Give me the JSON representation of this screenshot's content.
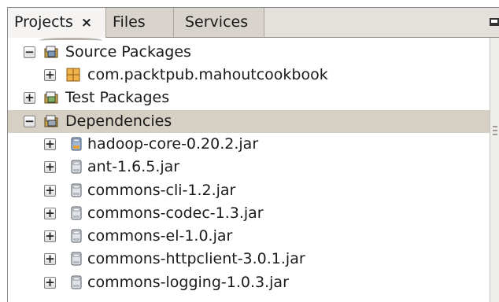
{
  "tabs": {
    "projects": "Projects",
    "projects_close": "×",
    "files": "Files",
    "services": "Services"
  },
  "tree": {
    "source_packages": "Source Packages",
    "package": "com.packtpub.mahoutcookbook",
    "test_packages": "Test Packages",
    "dependencies": "Dependencies",
    "jars": [
      "hadoop-core-0.20.2.jar",
      "ant-1.6.5.jar",
      "commons-cli-1.2.jar",
      "commons-codec-1.3.jar",
      "commons-el-1.0.jar",
      "commons-httpclient-3.0.1.jar",
      "commons-logging-1.0.3.jar"
    ],
    "expand_symbol": "+",
    "collapse_symbol": "−"
  },
  "colors": {
    "selection": "#d6d0c4",
    "package_icon": "#e6a23c",
    "library_icon": "#8aa5c7"
  },
  "icons": {
    "source_packages": "source-folder-icon",
    "package": "package-icon",
    "test_packages": "test-folder-icon",
    "dependencies": "library-folder-icon",
    "jar": "jar-file-icon"
  }
}
